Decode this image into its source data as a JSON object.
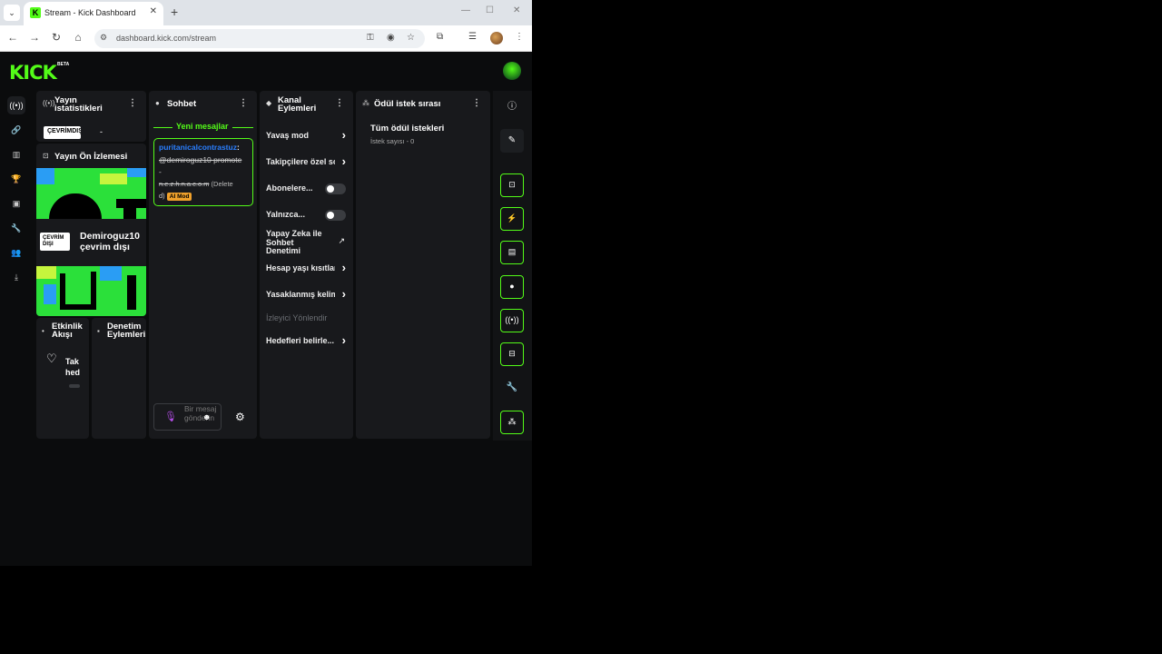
{
  "browser": {
    "tab_title": "Stream - Kick Dashboard",
    "tab_favicon": "K",
    "url": "dashboard.kick.com/stream"
  },
  "app": {
    "logo": "KICK",
    "logo_badge": "BETA"
  },
  "panels": {
    "stats": {
      "title": "Yayın istatistikleri",
      "status_badge": "ÇEVRİMDIŞI",
      "dash": "-"
    },
    "preview": {
      "title": "Yayın Ön İzlemesi",
      "status_badge": "ÇEVRİM DIŞI",
      "offline_text": "Demiroguz10 çevrim dışı"
    },
    "activity": {
      "title": "Etkinlik Akışı",
      "item_text": "Tak hed"
    },
    "moderation": {
      "title": "Denetim Eylemleri"
    },
    "chat": {
      "title": "Sohbet",
      "new_messages": "Yeni mesajlar",
      "message": {
        "username": "puritanicalcontrastuz",
        "colon": ":",
        "line1": "@demiroguz10 promote",
        "line2": "-",
        "line3": "n.e.z.h.n.a.c.o.m",
        "deleted_a": "(Delete",
        "deleted_b": "d)",
        "mod_badge": "AI Mod"
      },
      "input_placeholder": "Bir mesaj gönderin"
    },
    "channel_actions": {
      "title": "Kanal Eylemleri",
      "items": [
        {
          "label": "Yavaş mod"
        },
        {
          "label": "Takipçilere özel sohbet"
        },
        {
          "label": "Abonelere..."
        },
        {
          "label": "Yalnızca..."
        },
        {
          "label": "Yapay Zeka ile Sohbet Denetimi"
        },
        {
          "label": "Hesap yaşı kısıtlaması"
        },
        {
          "label": "Yasaklanmış kelimeler"
        },
        {
          "label": "İzleyici Yönlendir"
        },
        {
          "label": "Hedefleri belirle..."
        }
      ]
    },
    "rewards": {
      "title": "Ödül istek sırası",
      "all_requests": "Tüm ödül istekleri",
      "request_count": "İstek sayısı - 0"
    }
  }
}
